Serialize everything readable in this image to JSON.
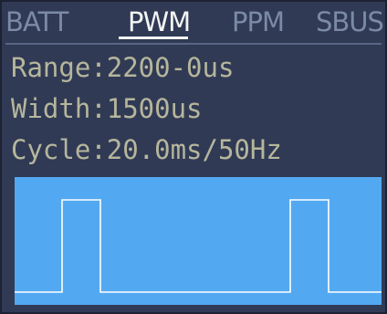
{
  "tabs": [
    {
      "label": "BATT",
      "active": false
    },
    {
      "label": "PWM",
      "active": true
    },
    {
      "label": "PPM",
      "active": false
    },
    {
      "label": "SBUS",
      "active": false
    }
  ],
  "info": {
    "range": "Range:2200-0us",
    "width": "Width:1500us",
    "cycle": "Cycle:20.0ms/50Hz"
  },
  "colors": {
    "background": "#303a55",
    "text": "#b6b69c",
    "tab_active": "#f4f4f4",
    "tab_inactive": "#7b8aa6",
    "waveform_bg": "#53a9f1",
    "waveform_line": "#ffffff"
  }
}
